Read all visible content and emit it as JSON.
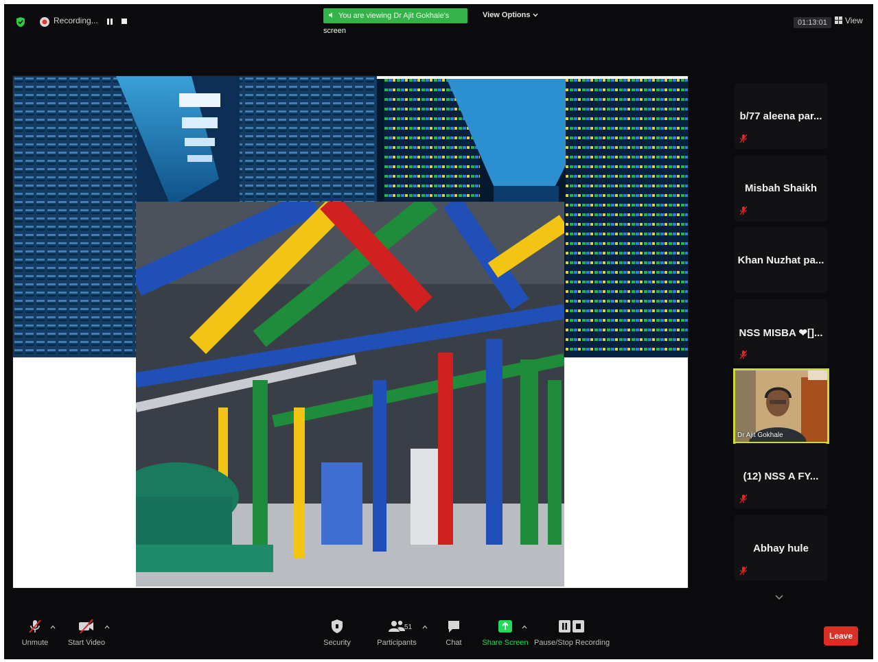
{
  "top_bar": {
    "recording_label": "Recording...",
    "viewing_banner": "You are viewing Dr Ajit Gokhale's screen",
    "view_options": "View Options",
    "timer": "01:13:01",
    "view_label": "View"
  },
  "participants": [
    {
      "name": "b/77 aleena par...",
      "muted": true
    },
    {
      "name": "Misbah Shaikh",
      "muted": true
    },
    {
      "name": "Khan Nuzhat pa...",
      "muted": false
    },
    {
      "name": "NSS MISBA ❤[]...",
      "muted": true
    },
    {
      "name": "(12) NSS  A  FY...",
      "muted": true
    },
    {
      "name": "Abhay hule",
      "muted": true
    }
  ],
  "active_speaker": {
    "name": "Dr Ajit Gokhale"
  },
  "toolbar": {
    "unmute": "Unmute",
    "start_video": "Start Video",
    "security": "Security",
    "participants": "Participants",
    "participant_count": "51",
    "chat": "Chat",
    "share_screen": "Share Screen",
    "pause_stop_recording": "Pause/Stop Recording",
    "leave": "Leave"
  },
  "colors": {
    "app_background": "#0b0b0d",
    "banner_green": "#35b34a",
    "share_green": "#23d959",
    "leave_red": "#d93025",
    "active_speaker_border": "#c9dc3a",
    "muted_red": "#e02828"
  },
  "icons": [
    "shield-icon",
    "record-icon",
    "grid-icon",
    "mic-muted-icon",
    "video-off-icon",
    "security-icon",
    "participants-icon",
    "chat-icon",
    "share-screen-icon",
    "pause-stop-recording-icon",
    "chevron-down-icon"
  ]
}
